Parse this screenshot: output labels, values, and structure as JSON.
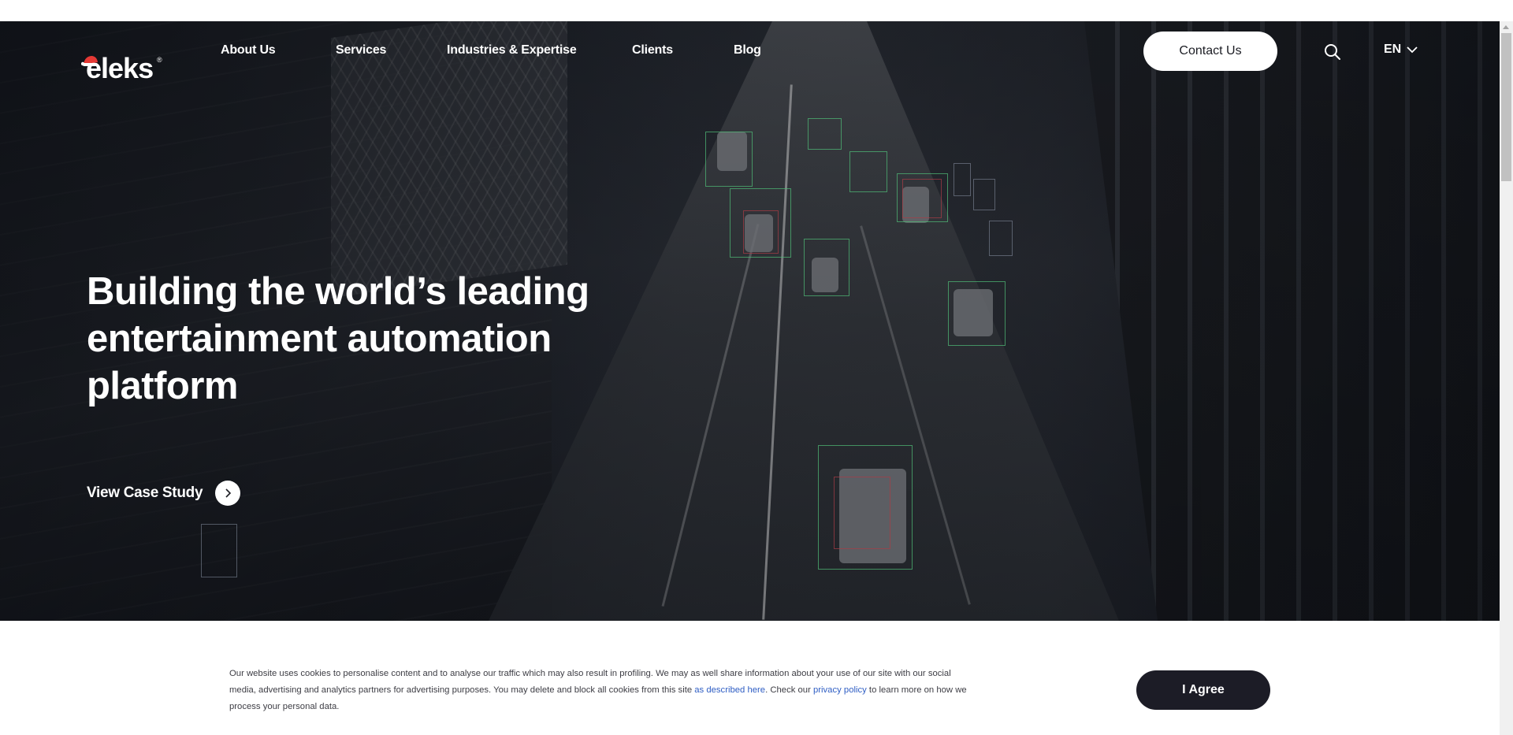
{
  "brand": {
    "logo_text": "eleks",
    "registered_mark": "®",
    "hat_color": "#e53935"
  },
  "nav": {
    "items": [
      {
        "label": "About Us"
      },
      {
        "label": "Services"
      },
      {
        "label": "Industries & Expertise"
      },
      {
        "label": "Clients"
      },
      {
        "label": "Blog"
      }
    ],
    "contact_label": "Contact Us",
    "search_icon": "search-icon",
    "language": "EN",
    "language_icon": "chevron-down-icon"
  },
  "hero": {
    "title": "Building the world’s leading entertainment automation platform",
    "cta_label": "View Case Study",
    "cta_icon": "chevron-right-icon"
  },
  "cookie_banner": {
    "text_before_link1": "Our website uses cookies to personalise content and to analyse our traffic which may also result in profiling. We may as well share information about your use of our site with our social media, advertising and analytics partners for advertising purposes. You may delete and block all cookies from this site ",
    "link1": "as described here",
    "text_between": ". Check our ",
    "link2": "privacy policy",
    "text_after": " to learn more on how we process your personal data.",
    "agree_label": "I Agree",
    "link_color": "#2f5ec4",
    "button_color": "#1c1c26"
  }
}
